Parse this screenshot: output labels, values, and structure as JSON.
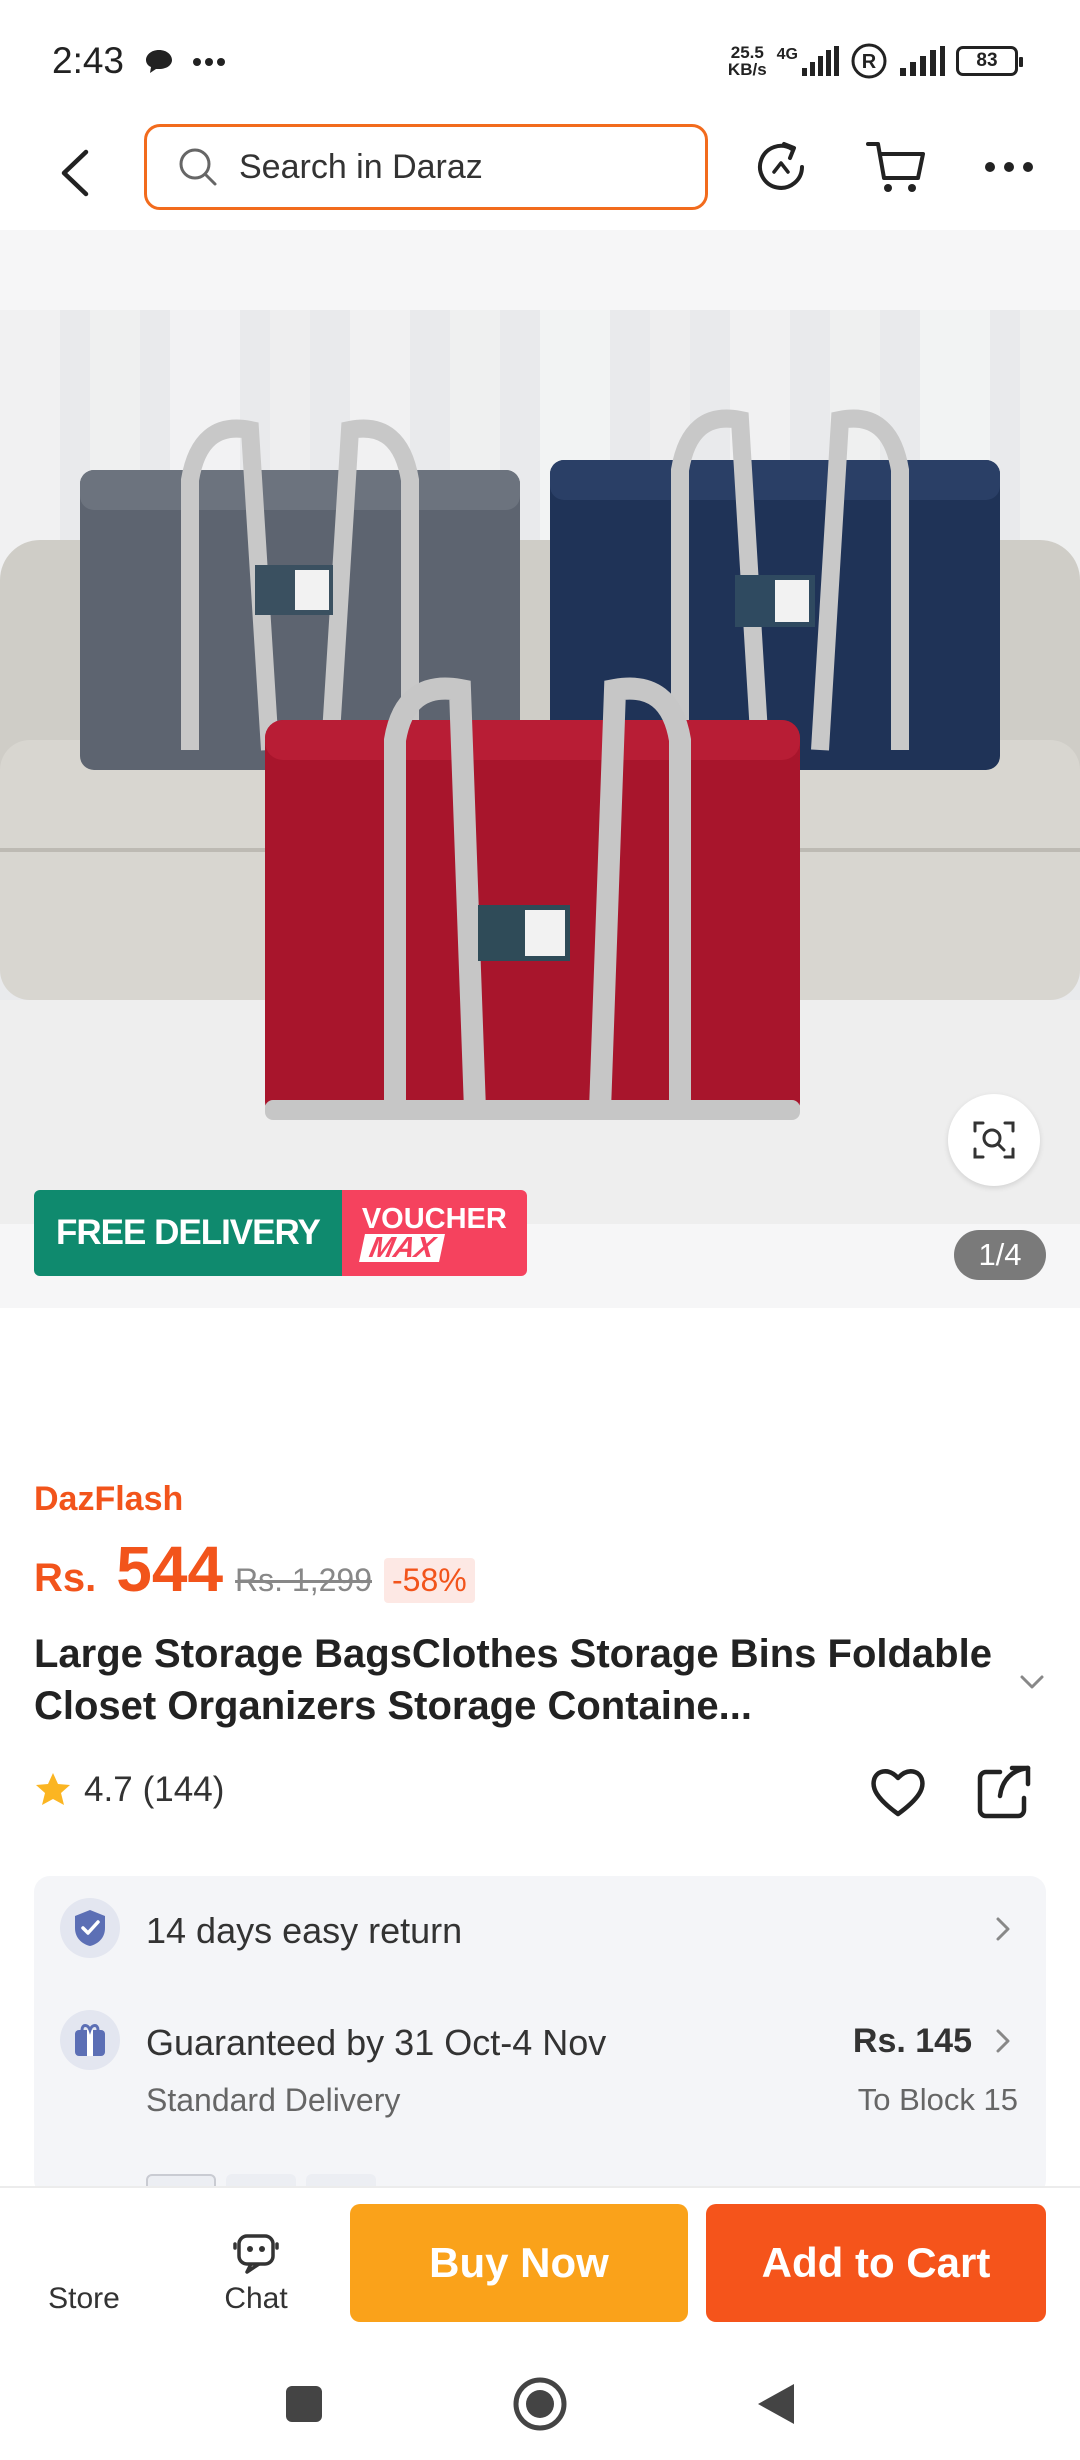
{
  "status_bar": {
    "time": "2:43",
    "net_speed_value": "25.5",
    "net_speed_unit": "KB/s",
    "network_type": "4G",
    "battery": "83"
  },
  "header": {
    "search_placeholder": "Search in Daraz"
  },
  "gallery": {
    "free_delivery": "FREE DELIVERY",
    "voucher_line1": "VOUCHER",
    "voucher_line2": "MAX",
    "page_indicator": "1/4"
  },
  "product": {
    "flash_label": "DazFlash",
    "currency": "Rs.",
    "price": "544",
    "original_price": "Rs. 1,299",
    "discount": "-58%",
    "title": "Large Storage BagsClothes Storage Bins Foldable Closet Organizers Storage Containe...",
    "rating": "4.7",
    "rating_count": "(144)",
    "rating_value": 4.7
  },
  "services": {
    "return_text": "14 days easy return",
    "delivery_text": "Guaranteed by 31 Oct-4 Nov",
    "delivery_sub": "Standard Delivery",
    "delivery_price": "Rs. 145",
    "delivery_location": "To Block 15"
  },
  "bottom_bar": {
    "store_label": "Store",
    "chat_label": "Chat",
    "buy_now": "Buy Now",
    "add_to_cart": "Add to Cart"
  },
  "colors": {
    "accent_orange": "#f5541b",
    "buy_now_yellow": "#faa21a",
    "free_delivery_green": "#0f8a6e",
    "voucher_pink": "#f5425e"
  }
}
